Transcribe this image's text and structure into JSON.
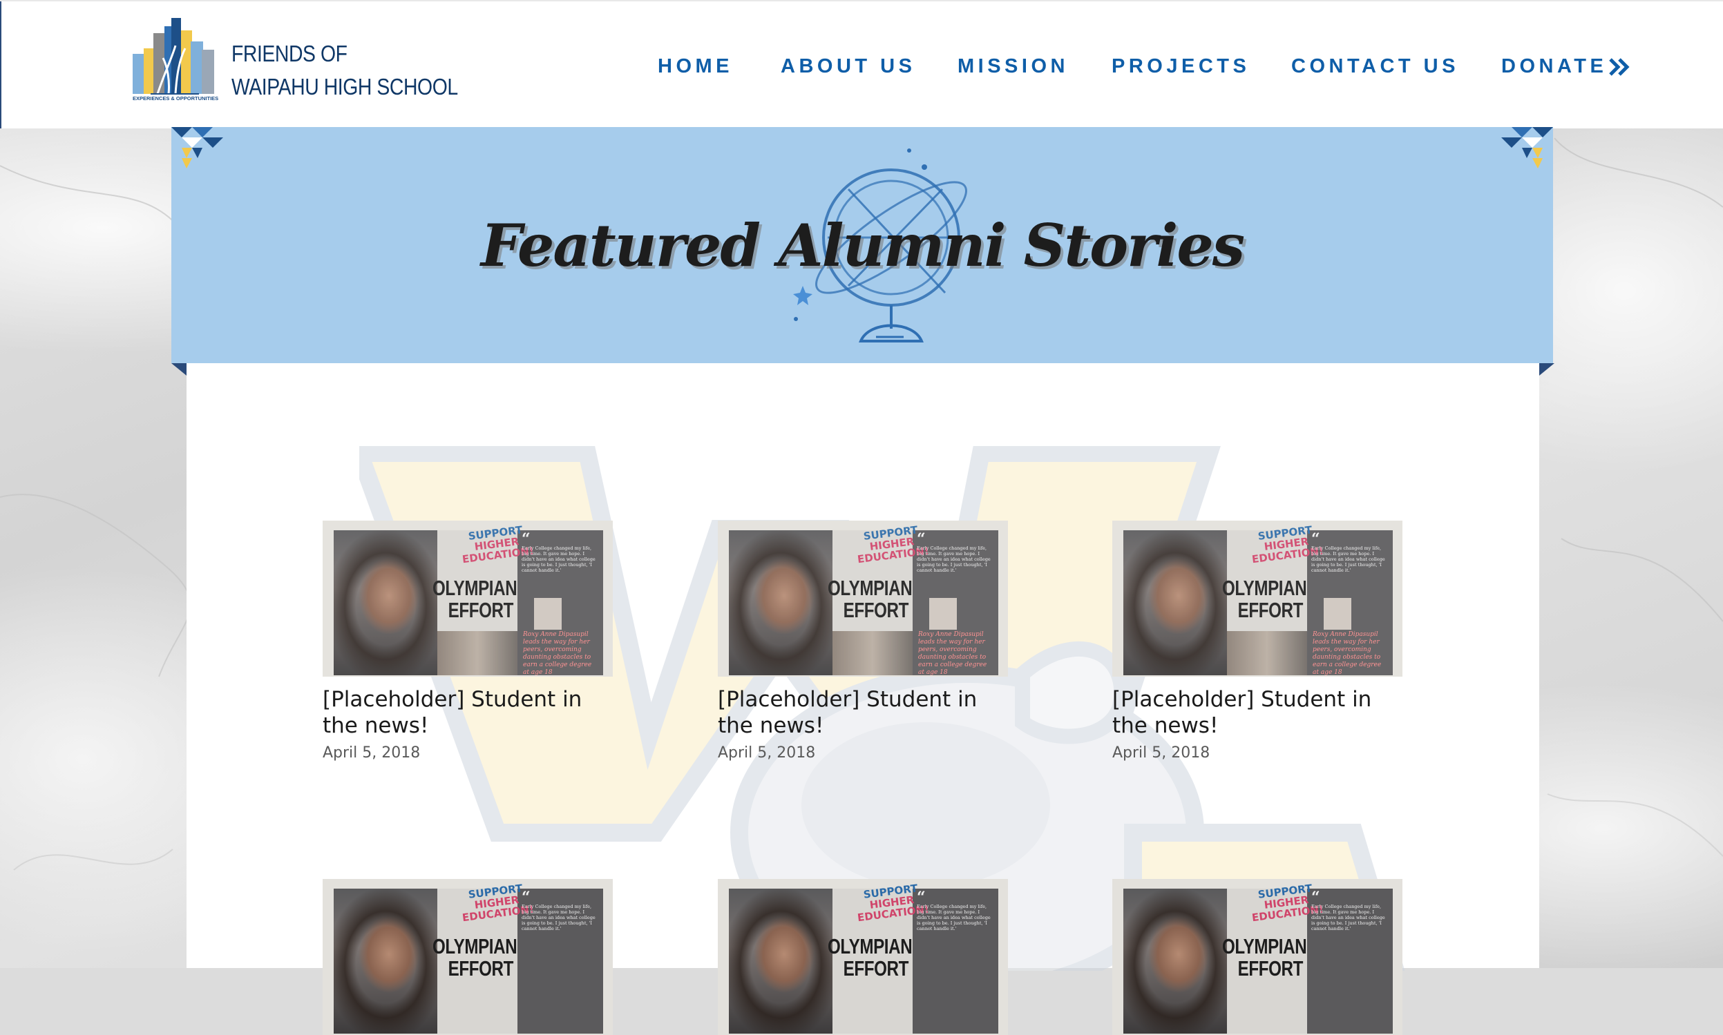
{
  "header": {
    "org_name_line1": "FRIENDS OF",
    "org_name_line2": "WAIPAHU HIGH SCHOOL",
    "logo_tagline": "EXPERIENCES & OPPORTUNITIES"
  },
  "nav": {
    "items": [
      {
        "label": "HOME"
      },
      {
        "label": "ABOUT US"
      },
      {
        "label": "MISSION"
      },
      {
        "label": "PROJECTS"
      },
      {
        "label": "CONTACT US"
      },
      {
        "label": "DONATE"
      }
    ],
    "donate_icon": "double-chevron-right-icon"
  },
  "banner": {
    "title": "Featured Alumni Stories",
    "icon": "globe-icon"
  },
  "posts": [
    {
      "title": "[Placeholder] Student in the news!",
      "date": "April 5, 2018",
      "thumb": {
        "support": "SUPPORT",
        "higher": "HIGHER EDUCATION!",
        "headline": "OLYMPIAN EFFORT",
        "quote": "Early College changed my life, big time. It gave me hope. I didn't have an idea what college is going to be. I just thought, 'I cannot handle it.'",
        "caption": "Roxy Anne Dipasupil leads the way for her peers, overcoming daunting obstacles to earn a college degree at age 18"
      }
    },
    {
      "title": "[Placeholder] Student in the news!",
      "date": "April 5, 2018",
      "thumb": {
        "support": "SUPPORT",
        "higher": "HIGHER EDUCATION!",
        "headline": "OLYMPIAN EFFORT",
        "quote": "Early College changed my life, big time. It gave me hope. I didn't have an idea what college is going to be. I just thought, 'I cannot handle it.'",
        "caption": "Roxy Anne Dipasupil leads the way for her peers, overcoming daunting obstacles to earn a college degree at age 18"
      }
    },
    {
      "title": "[Placeholder] Student in the news!",
      "date": "April 5, 2018",
      "thumb": {
        "support": "SUPPORT",
        "higher": "HIGHER EDUCATION!",
        "headline": "OLYMPIAN EFFORT",
        "quote": "Early College changed my life, big time. It gave me hope. I didn't have an idea what college is going to be. I just thought, 'I cannot handle it.'",
        "caption": "Roxy Anne Dipasupil leads the way for her peers, overcoming daunting obstacles to earn a college degree at age 18"
      }
    },
    {
      "title": "",
      "date": "",
      "thumb": {
        "support": "SUPPORT",
        "higher": "HIGHER EDUCATION!",
        "headline": "OLYMPIAN EFFORT",
        "quote": "Early College changed my life, big time. It gave me hope. I didn't have an idea what college is going to be. I just thought, 'I cannot handle it.'",
        "caption": ""
      }
    },
    {
      "title": "",
      "date": "",
      "thumb": {
        "support": "SUPPORT",
        "higher": "HIGHER EDUCATION!",
        "headline": "OLYMPIAN EFFORT",
        "quote": "Early College changed my life, big time. It gave me hope. I didn't have an idea what college is going to be. I just thought, 'I cannot handle it.'",
        "caption": ""
      }
    },
    {
      "title": "",
      "date": "",
      "thumb": {
        "support": "SUPPORT",
        "higher": "HIGHER EDUCATION!",
        "headline": "OLYMPIAN EFFORT",
        "quote": "Early College changed my life, big time. It gave me hope. I didn't have an idea what college is going to be. I just thought, 'I cannot handle it.'",
        "caption": ""
      }
    }
  ],
  "colors": {
    "nav_text": "#0f5ea8",
    "org_name": "#0f3766",
    "banner_bg": "#a6ccec",
    "accent_gold": "#f2c94c"
  }
}
